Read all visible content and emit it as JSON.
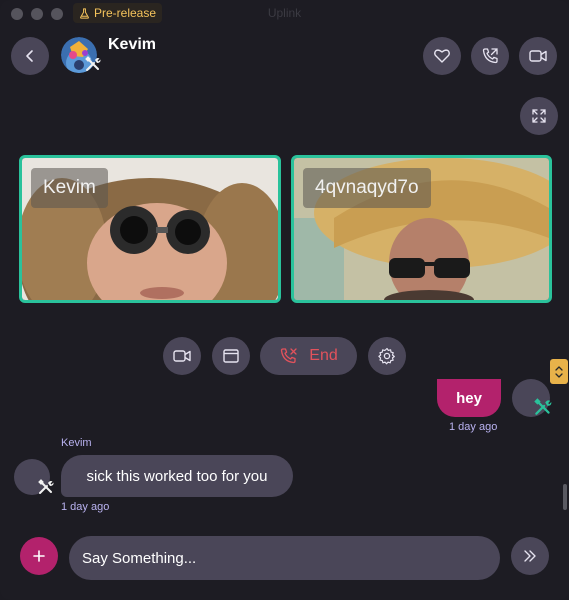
{
  "window": {
    "title": "Uplink",
    "badge": "Pre-release"
  },
  "header": {
    "contact_name": "Kevim"
  },
  "call": {
    "participants": [
      {
        "name": "Kevim"
      },
      {
        "name": "4qvnaqyd7o"
      }
    ],
    "end_label": "End"
  },
  "messages": [
    {
      "direction": "outgoing",
      "text": "hey",
      "time": "1 day ago"
    },
    {
      "direction": "incoming",
      "sender": "Kevim",
      "text": "sick this worked too for you",
      "time": "1 day ago"
    }
  ],
  "composer": {
    "placeholder": "Say Something..."
  },
  "colors": {
    "accent": "#b3226c",
    "tile_border": "#2ac29b",
    "end_red": "#e2525c",
    "button_bg": "#4a4658",
    "meta_text": "#b9b2f0"
  }
}
